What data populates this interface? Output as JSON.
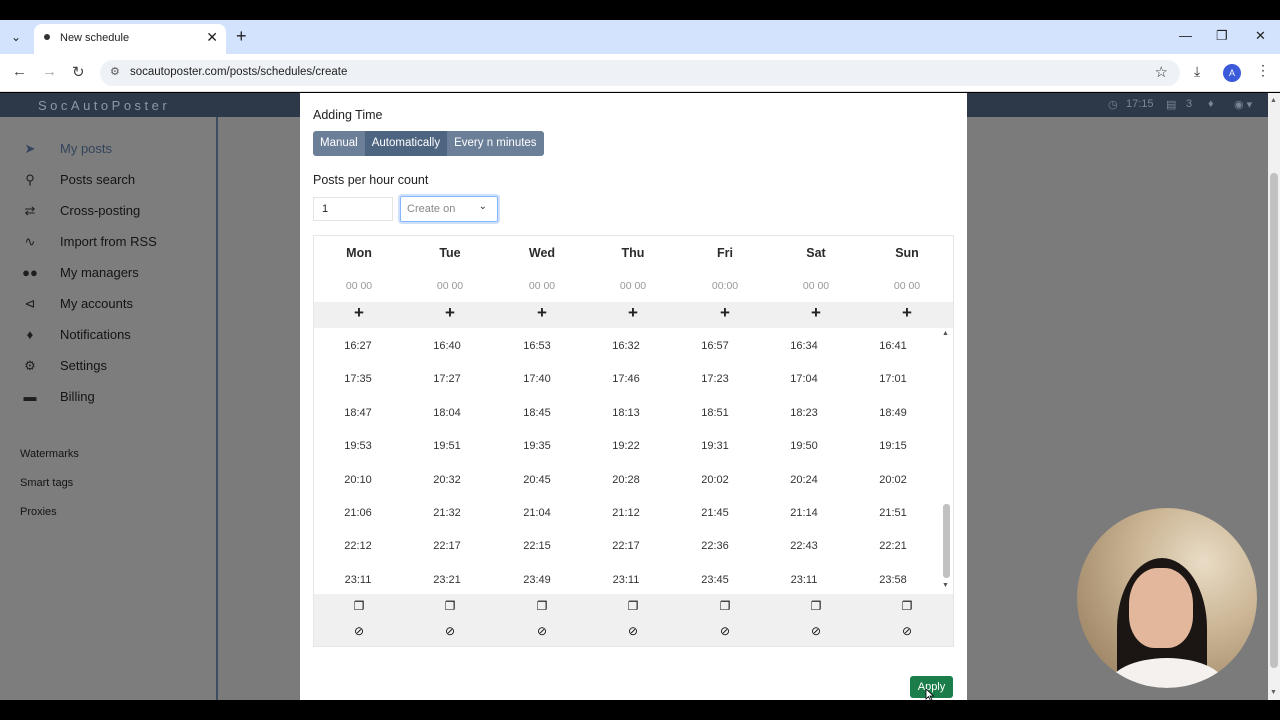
{
  "browser": {
    "tab_title": "New schedule",
    "url": "socautoposter.com/posts/schedules/create",
    "profile_initial": "A"
  },
  "app": {
    "brand": "SocAutoPoster",
    "header_time": "17:15",
    "header_count": "3",
    "sidebar": {
      "items": [
        {
          "label": "My posts",
          "icon": "send-icon"
        },
        {
          "label": "Posts search",
          "icon": "search-icon"
        },
        {
          "label": "Cross-posting",
          "icon": "exchange-icon"
        },
        {
          "label": "Import from RSS",
          "icon": "rss-icon"
        },
        {
          "label": "My managers",
          "icon": "users-icon"
        },
        {
          "label": "My accounts",
          "icon": "share-icon"
        },
        {
          "label": "Notifications",
          "icon": "bell-icon"
        },
        {
          "label": "Settings",
          "icon": "gears-icon"
        },
        {
          "label": "Billing",
          "icon": "credit-card-icon"
        }
      ],
      "extra": [
        "Watermarks",
        "Smart tags",
        "Proxies"
      ]
    }
  },
  "modal": {
    "adding_time_label": "Adding Time",
    "modes": [
      "Manual",
      "Automatically",
      "Every n minutes"
    ],
    "posts_per_hour_label": "Posts per hour count",
    "posts_per_hour_value": "1",
    "create_on_placeholder": "Create on",
    "days": [
      "Mon",
      "Tue",
      "Wed",
      "Thu",
      "Fri",
      "Sat",
      "Sun"
    ],
    "time_inputs": [
      "00 00",
      "00 00",
      "00 00",
      "00 00",
      "00:00",
      "00 00",
      "00 00"
    ],
    "times": [
      [
        "16:27",
        "16:40",
        "16:53",
        "16:32",
        "16:57",
        "16:34",
        "16:41"
      ],
      [
        "17:35",
        "17:27",
        "17:40",
        "17:46",
        "17:23",
        "17:04",
        "17:01"
      ],
      [
        "18:47",
        "18:04",
        "18:45",
        "18:13",
        "18:51",
        "18:23",
        "18:49"
      ],
      [
        "19:53",
        "19:51",
        "19:35",
        "19:22",
        "19:31",
        "19:50",
        "19:15"
      ],
      [
        "20:10",
        "20:32",
        "20:45",
        "20:28",
        "20:02",
        "20:24",
        "20:02"
      ],
      [
        "21:06",
        "21:32",
        "21:04",
        "21:12",
        "21:45",
        "21:14",
        "21:51"
      ],
      [
        "22:12",
        "22:17",
        "22:15",
        "22:17",
        "22:36",
        "22:43",
        "22:21"
      ],
      [
        "23:11",
        "23:21",
        "23:49",
        "23:11",
        "23:45",
        "23:11",
        "23:58"
      ]
    ],
    "apply_label": "Apply"
  }
}
